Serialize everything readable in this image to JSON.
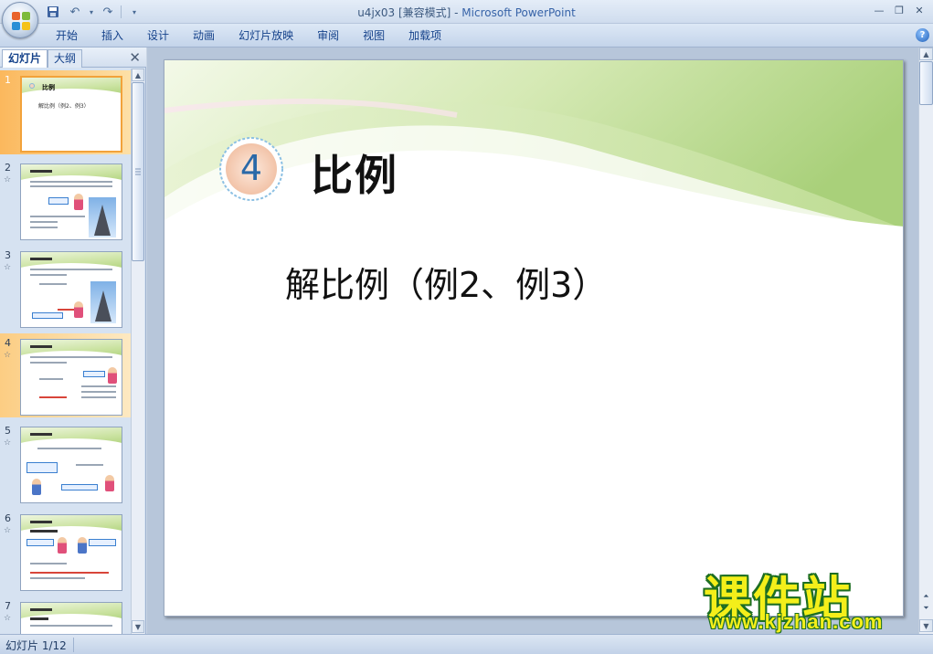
{
  "window": {
    "title": "u4jx03 [兼容模式] - ",
    "app_name": "Microsoft PowerPoint"
  },
  "quick_access": {
    "save_icon": "save-icon",
    "undo_icon": "undo-icon",
    "redo_icon": "redo-icon"
  },
  "ribbon": {
    "tabs": [
      "开始",
      "插入",
      "设计",
      "动画",
      "幻灯片放映",
      "审阅",
      "视图",
      "加载项"
    ],
    "help_label": "?"
  },
  "panel": {
    "tab_slides": "幻灯片",
    "tab_outline": "大纲",
    "close_label": "✕"
  },
  "thumbnails": [
    {
      "num": "1",
      "title": "比例",
      "sub": "解比例（例2、例3）"
    },
    {
      "num": "2",
      "star": "☆"
    },
    {
      "num": "3",
      "star": "☆"
    },
    {
      "num": "4",
      "star": "☆"
    },
    {
      "num": "5",
      "star": "☆"
    },
    {
      "num": "6",
      "star": "☆"
    },
    {
      "num": "7",
      "star": "☆"
    }
  ],
  "slide": {
    "badge_number": "4",
    "title": "比例",
    "subtitle": "解比例（例2、例3）"
  },
  "watermark": {
    "cn": "课件站",
    "url": "www.kjzhan.com"
  },
  "status": {
    "slide_counter": "幻灯片 1/12"
  },
  "colors": {
    "selection": "#fbb85d",
    "ribbon_text": "#15428b",
    "badge_text": "#2a69a8"
  }
}
